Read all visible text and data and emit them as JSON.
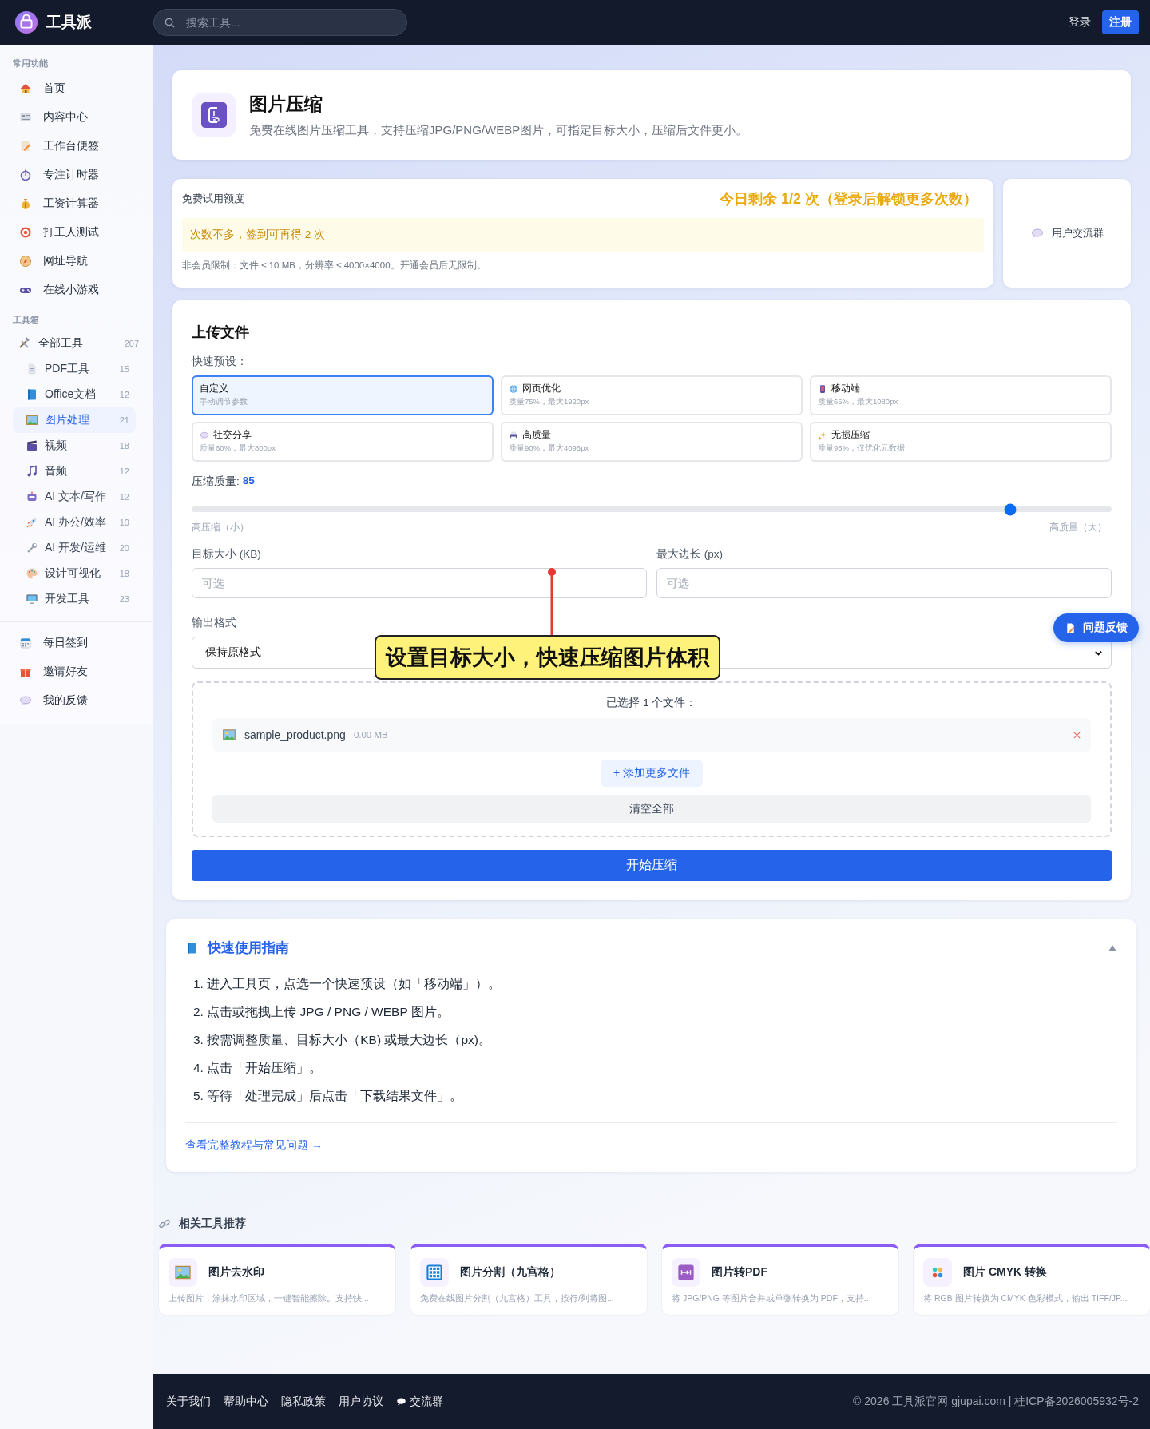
{
  "header": {
    "brand": "工具派",
    "search": {
      "placeholder": "搜索工具..."
    },
    "login": "登录",
    "register": "注册"
  },
  "sidebar": {
    "sections": [
      {
        "title": "常用功能",
        "items": [
          {
            "label": "首页",
            "selected": false
          },
          {
            "label": "内容中心",
            "selected": false
          },
          {
            "label": "工作台便签",
            "selected": false
          },
          {
            "label": "专注计时器",
            "selected": false
          },
          {
            "label": "工资计算器",
            "selected": false
          },
          {
            "label": "打工人测试",
            "selected": false
          },
          {
            "label": "网址导航",
            "selected": false
          },
          {
            "label": "在线小游戏",
            "selected": false
          }
        ]
      },
      {
        "title": "工具箱",
        "items": [
          {
            "label": "全部工具",
            "count": "207",
            "selected": false,
            "children": [
              {
                "label": "PDF工具",
                "count": "15",
                "selected": false
              },
              {
                "label": "Office文档",
                "count": "12",
                "selected": false
              },
              {
                "label": "图片处理",
                "count": "21",
                "selected": true
              },
              {
                "label": "视频",
                "count": "18",
                "selected": false
              },
              {
                "label": "音频",
                "count": "12",
                "selected": false
              },
              {
                "label": "AI 文本/写作",
                "count": "12",
                "selected": false
              },
              {
                "label": "AI 办公/效率",
                "count": "10",
                "selected": false
              },
              {
                "label": "AI 开发/运维",
                "count": "20",
                "selected": false
              },
              {
                "label": "设计可视化",
                "count": "18",
                "selected": false
              },
              {
                "label": "开发工具",
                "count": "23",
                "selected": false
              }
            ]
          }
        ]
      },
      {
        "items": [
          {
            "label": "每日签到",
            "selected": false
          },
          {
            "label": "邀请好友",
            "selected": false
          },
          {
            "label": "我的反馈",
            "selected": false
          }
        ]
      }
    ]
  },
  "page": {
    "title": "图片压缩",
    "description": "免费在线图片压缩工具，支持压缩JPG/PNG/WEBP图片，可指定目标大小，压缩后文件更小。"
  },
  "quota": {
    "label": "免费试用额度",
    "remaining": "今日剩余 1/2 次（登录后解锁更多次数）",
    "notice": "次数不多，签到可再得 2 次",
    "limits": "非会员限制：文件 ≤ 10 MB，分辨率 ≤ 4000×4000。开通会员后无限制。"
  },
  "community": {
    "label": "用户交流群"
  },
  "upload": {
    "title": "上传文件",
    "presets_label": "快速预设：",
    "presets": [
      {
        "name": "自定义",
        "description": "手动调节参数",
        "selected": true
      },
      {
        "name": "网页优化",
        "description": "质量75%，最大1920px",
        "selected": false
      },
      {
        "name": "移动端",
        "description": "质量65%，最大1080px",
        "selected": false
      },
      {
        "name": "社交分享",
        "description": "质量60%，最大800px",
        "selected": false
      },
      {
        "name": "高质量",
        "description": "质量90%，最大4096px",
        "selected": false
      },
      {
        "name": "无损压缩",
        "description": "质量95%，仅优化元数据",
        "selected": false
      }
    ],
    "quality": {
      "label": "压缩质量:",
      "reading": "85",
      "level": 0.89,
      "min_label": "高压缩（小）",
      "max_label": "高质量（大）"
    },
    "target_size": {
      "label": "目标大小 (KB)",
      "placeholder": "可选"
    },
    "max_edge": {
      "label": "最大边长 (px)",
      "placeholder": "可选"
    },
    "format": {
      "label": "输出格式",
      "value": "保持原格式"
    },
    "files": {
      "summary": "已选择 1 个文件：",
      "items": [
        {
          "name": "sample_product.png",
          "size": "0.00 MB"
        }
      ],
      "add_more": "+ 添加更多文件",
      "clear": "清空全部"
    },
    "start": "开始压缩"
  },
  "callout": "设置目标大小，快速压缩图片体积",
  "feedback_button": "问题反馈",
  "guide": {
    "title": "快速使用指南",
    "expanded": true,
    "steps": [
      "1. 进入工具页，点选一个快速预设（如「移动端」）。",
      "2. 点击或拖拽上传 JPG / PNG / WEBP 图片。",
      "3. 按需调整质量、目标大小（KB) 或最大边长（px)。",
      "4. 点击「开始压缩」。",
      "5. 等待「处理完成」后点击「下载结果文件」。"
    ],
    "link": "查看完整教程与常见问题 →"
  },
  "related": {
    "title": "相关工具推荐",
    "tools": [
      {
        "name": "图片去水印",
        "description": "上传图片，涂抹水印区域，一键智能擦除。支持快..."
      },
      {
        "name": "图片分割（九宫格）",
        "description": "免费在线图片分割（九宫格）工具，按行/列将图..."
      },
      {
        "name": "图片转PDF",
        "description": "将 JPG/PNG 等图片合并或单张转换为 PDF，支持..."
      },
      {
        "name": "图片 CMYK 转换",
        "description": "将 RGB 图片转换为 CMYK 色彩模式，输出 TIFF/JP..."
      }
    ]
  },
  "footer": {
    "links": [
      "关于我们",
      "帮助中心",
      "隐私政策",
      "用户协议",
      "交流群"
    ],
    "copyright": "© 2026 工具派官网 gjupai.com | 桂ICP备2026005932号-2"
  }
}
